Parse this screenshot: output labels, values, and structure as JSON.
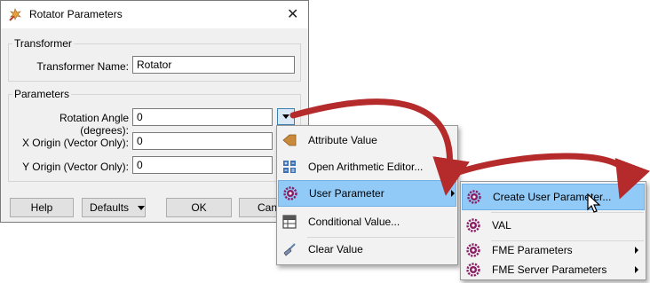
{
  "dialog": {
    "title": "Rotator Parameters",
    "close_glyph": "✕",
    "transformer_group": {
      "legend": "Transformer",
      "name_label": "Transformer Name:",
      "name_value": "Rotator"
    },
    "parameters_group": {
      "legend": "Parameters",
      "rotation_label": "Rotation Angle (degrees):",
      "rotation_value": "0",
      "x_origin_label": "X Origin (Vector Only):",
      "x_origin_value": "0",
      "y_origin_label": "Y Origin (Vector Only):",
      "y_origin_value": "0"
    },
    "buttons": {
      "help": "Help",
      "defaults": "Defaults",
      "ok": "OK",
      "cancel": "Canc"
    }
  },
  "context_menu": {
    "items": [
      {
        "label": "Attribute Value",
        "icon": "attribute-icon"
      },
      {
        "label": "Open Arithmetic Editor...",
        "icon": "calculator-grid-icon"
      },
      {
        "label": "User Parameter",
        "icon": "user-parameter-gear-icon",
        "highlighted": true,
        "submenu": true
      },
      {
        "label": "Conditional Value...",
        "icon": "table-icon"
      },
      {
        "label": "Clear Value",
        "icon": "broom-icon"
      }
    ]
  },
  "submenu": {
    "items": [
      {
        "label": "Create User Parameter...",
        "icon": "user-parameter-gear-icon",
        "highlighted": true
      },
      {
        "label": "VAL",
        "icon": "user-parameter-gear-icon"
      },
      {
        "label": "FME Parameters",
        "icon": "user-parameter-gear-icon",
        "submenu": true
      },
      {
        "label": "FME Server Parameters",
        "icon": "user-parameter-gear-icon",
        "submenu": true
      }
    ]
  },
  "colors": {
    "highlight": "#91c9f7",
    "annotation_arrow": "#b52a2a",
    "gear_icon": "#8a1e64"
  }
}
